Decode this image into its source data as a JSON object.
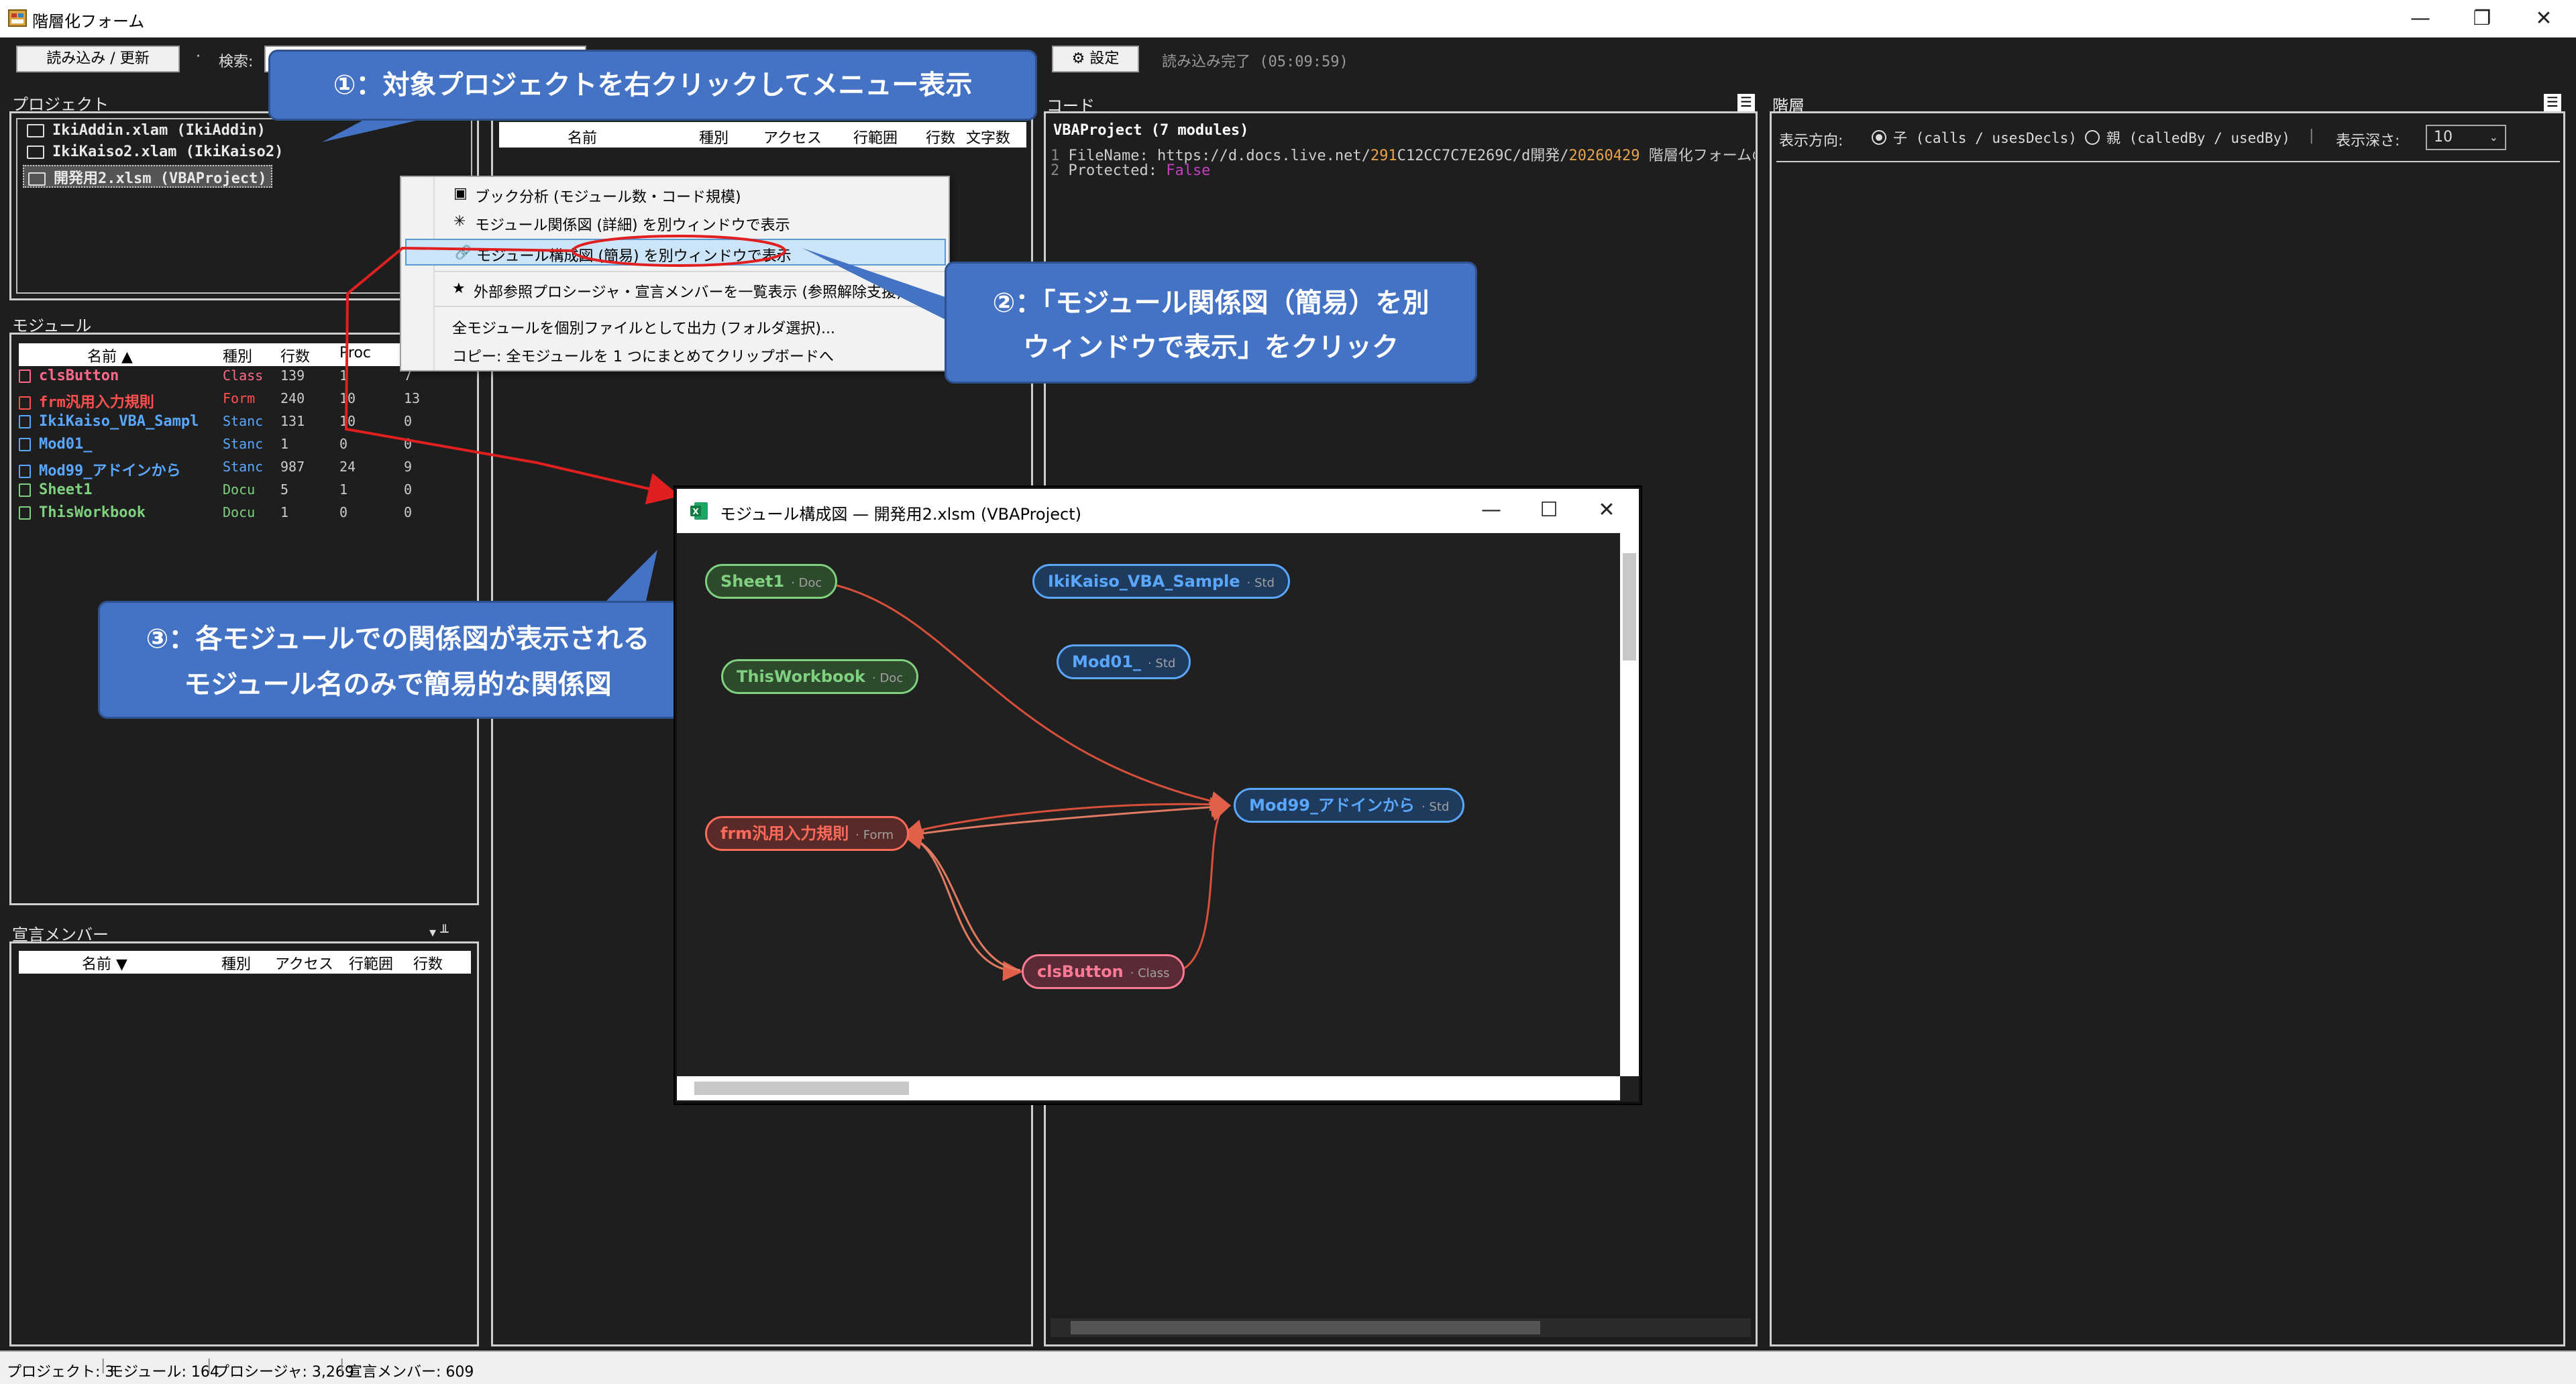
{
  "window": {
    "title": "階層化フォーム",
    "minimize": "—",
    "restore": "❐",
    "close": "✕"
  },
  "toolbar": {
    "reload_label": "読み込み / 更新",
    "search_label": "検索:",
    "search_value": "",
    "settings_label": "設定",
    "status_text": "読み込み完了 (05:09:59)"
  },
  "project_panel": {
    "title": "プロジェクト",
    "items": [
      {
        "label": "IkiAddin.xlam (IkiAddin)"
      },
      {
        "label": "IkiKaiso2.xlam (IkiKaiso2)"
      },
      {
        "label": "開発用2.xlsm (VBAProject)"
      }
    ]
  },
  "proc_list": {
    "columns": [
      "名前",
      "種別",
      "アクセス",
      "行範囲",
      "行数",
      "文字数"
    ]
  },
  "module_panel": {
    "title": "モジュール",
    "columns": [
      "名前 ▲",
      "種別",
      "行数",
      "Proc"
    ],
    "rows": [
      {
        "name": "clsButton",
        "kind": "Class",
        "lines": "139",
        "a": "1",
        "b": "7",
        "color": "#ff6a8a"
      },
      {
        "name": "frm汎用入力規則",
        "kind": "Form",
        "lines": "240",
        "a": "10",
        "b": "13",
        "color": "#ff5050"
      },
      {
        "name": "IkiKaiso_VBA_Sampl",
        "kind": "Stanc",
        "lines": "131",
        "a": "10",
        "b": "0",
        "color": "#5aa7ff"
      },
      {
        "name": "Mod01_",
        "kind": "Stanc",
        "lines": "1",
        "a": "0",
        "b": "0",
        "color": "#5aa7ff"
      },
      {
        "name": "Mod99_アドインから",
        "kind": "Stanc",
        "lines": "987",
        "a": "24",
        "b": "9",
        "color": "#5aa7ff"
      },
      {
        "name": "Sheet1",
        "kind": "Docu",
        "lines": "5",
        "a": "1",
        "b": "0",
        "color": "#7fd07f"
      },
      {
        "name": "ThisWorkbook",
        "kind": "Docu",
        "lines": "1",
        "a": "0",
        "b": "0",
        "color": "#7fd07f"
      }
    ]
  },
  "member_panel": {
    "title": "宣言メンバー",
    "pin": "▾ ╨",
    "columns": [
      "名前 ▼",
      "種別",
      "アクセス",
      "行範囲",
      "行数"
    ]
  },
  "code_panel": {
    "title": "コード",
    "header": "VBAProject (7 modules)",
    "lines": [
      {
        "no": "1",
        "prefix": "FileName: https://d.docs.live.net/",
        "hl1": "291",
        "mid": "C12CC7C7E269C/d開発/",
        "hl2": "20260429",
        "suffix": " 階層化フォームの親コ"
      },
      {
        "no": "2",
        "prefix": "Protected: ",
        "value": "False"
      }
    ]
  },
  "hier_panel": {
    "title": "階層",
    "direction_label": "表示方向:",
    "opt_child": "子 (calls / usesDecls)",
    "opt_parent": "親 (calledBy / usedBy)",
    "separator": "|",
    "depth_label": "表示深さ:",
    "depth_value": "10"
  },
  "context_menu": {
    "items": [
      {
        "icon": "▣",
        "label": "ブック分析 (モジュール数・コード規模)"
      },
      {
        "icon": "✳",
        "label": "モジュール関係図 (詳細) を別ウィンドウで表示"
      },
      {
        "icon": "🔗",
        "label": "モジュール構成図 (簡易) を別ウィンドウで表示"
      },
      {
        "icon": "★",
        "label": "外部参照プロシージャ・宣言メンバーを一覧表示 (参照解除支援)"
      },
      {
        "icon": "",
        "label": "全モジュールを個別ファイルとして出力 (フォルダ選択)..."
      },
      {
        "icon": "",
        "label": "コピー: 全モジュールを 1 つにまとめてクリップボードへ"
      }
    ]
  },
  "callouts": {
    "c1": "①：対象プロジェクトを右クリックしてメニュー表示",
    "c2_line1": "②：「モジュール関係図（簡易）を別",
    "c2_line2": "ウィンドウで表示」をクリック",
    "c3_line1": "③：各モジュールでの関係図が表示される",
    "c3_line2": "モジュール名のみで簡易的な関係図"
  },
  "graph_window": {
    "title": "モジュール構成図 — 開発用2.xlsm (VBAProject)",
    "minimize": "—",
    "maximize": "☐",
    "close": "✕",
    "nodes": [
      {
        "name": "Sheet1",
        "tag": "· Doc",
        "color": "#7fd07f",
        "bg": "#2d4a2d"
      },
      {
        "name": "IkiKaiso_VBA_Sample",
        "tag": "· Std",
        "color": "#5aa7ff",
        "bg": "#1e3a5c"
      },
      {
        "name": "Mod01_",
        "tag": "· Std",
        "color": "#5aa7ff",
        "bg": "#1e3a5c"
      },
      {
        "name": "ThisWorkbook",
        "tag": "· Doc",
        "color": "#7fd07f",
        "bg": "#2d4a2d"
      },
      {
        "name": "Mod99_アドインから",
        "tag": "· Std",
        "color": "#5aa7ff",
        "bg": "#1e3a5c"
      },
      {
        "name": "frm汎用入力規則",
        "tag": "· Form",
        "color": "#ff6a5a",
        "bg": "#5a2a28"
      },
      {
        "name": "clsButton",
        "tag": "· Class",
        "color": "#ff7a95",
        "bg": "#5a2a36"
      }
    ]
  },
  "statusbar": {
    "projects": "プロジェクト: 3",
    "modules": "モジュール: 164",
    "procedures": "プロシージャ: 3,269",
    "members": "宣言メンバー: 609"
  }
}
